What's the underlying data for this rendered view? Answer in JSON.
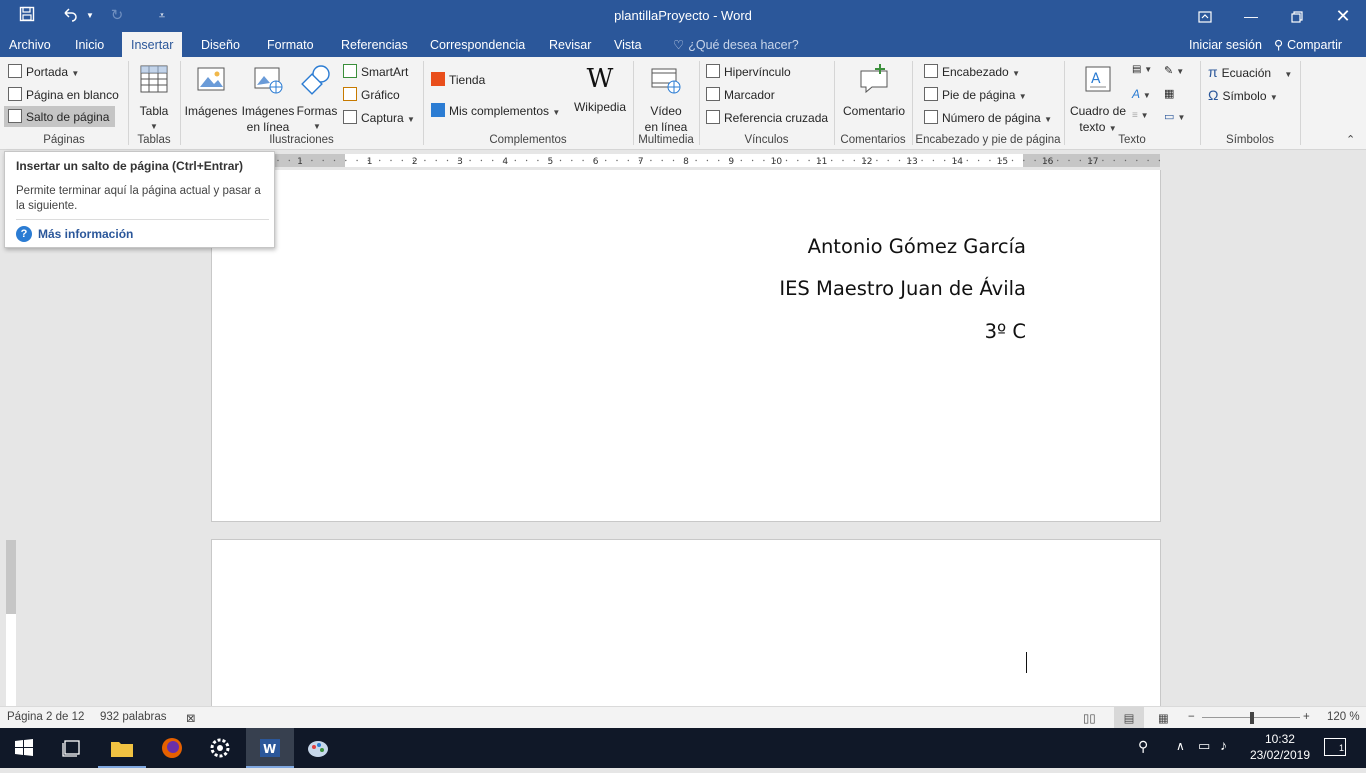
{
  "window": {
    "title": "plantillaProyecto - Word"
  },
  "tabs": {
    "archivo": "Archivo",
    "inicio": "Inicio",
    "insertar": "Insertar",
    "diseno": "Diseño",
    "formato": "Formato",
    "referencias": "Referencias",
    "correspondencia": "Correspondencia",
    "revisar": "Revisar",
    "vista": "Vista",
    "ask": "¿Qué desea hacer?",
    "signin": "Iniciar sesión",
    "share": "Compartir"
  },
  "ribbon": {
    "paginas": {
      "portada": "Portada",
      "pagina_blanco": "Página en blanco",
      "salto": "Salto de página",
      "label": "Páginas"
    },
    "tablas": {
      "tabla": "Tabla",
      "label": "Tablas"
    },
    "ilustraciones": {
      "imagenes": "Imágenes",
      "imagenes_linea_1": "Imágenes",
      "imagenes_linea_2": "en línea",
      "formas": "Formas",
      "smartart": "SmartArt",
      "grafico": "Gráfico",
      "captura": "Captura",
      "label": "Ilustraciones"
    },
    "complementos": {
      "tienda": "Tienda",
      "mis": "Mis complementos",
      "wikipedia": "Wikipedia",
      "label": "Complementos"
    },
    "multimedia": {
      "video_1": "Vídeo",
      "video_2": "en línea",
      "label": "Multimedia"
    },
    "vinculos": {
      "hipervinculo": "Hipervínculo",
      "marcador": "Marcador",
      "referencia": "Referencia cruzada",
      "label": "Vínculos"
    },
    "comentarios": {
      "comentario": "Comentario",
      "label": "Comentarios"
    },
    "encabezado": {
      "encabezado": "Encabezado",
      "pie": "Pie de página",
      "numero": "Número de página",
      "label": "Encabezado y pie de página"
    },
    "texto": {
      "cuadro_1": "Cuadro de",
      "cuadro_2": "texto",
      "label": "Texto"
    },
    "simbolos": {
      "ecuacion": "Ecuación",
      "simbolo": "Símbolo",
      "label": "Símbolos"
    }
  },
  "tooltip": {
    "title": "Insertar un salto de página (Ctrl+Entrar)",
    "body": "Permite terminar aquí la página actual y pasar a la siguiente.",
    "link": "Más información"
  },
  "document": {
    "line1": "Antonio Gómez García",
    "line2": "IES Maestro Juan de Ávila",
    "line3": "3º C"
  },
  "ruler": {
    "ticks": [
      "1",
      "1",
      "2",
      "3",
      "4",
      "5",
      "6",
      "7",
      "8",
      "9",
      "10",
      "11",
      "12",
      "13",
      "14",
      "15",
      "16",
      "17"
    ]
  },
  "status": {
    "page": "Página 2 de 12",
    "words": "932 palabras",
    "zoom": "120 %"
  },
  "taskbar": {
    "time": "10:32",
    "date": "23/02/2019",
    "notifications": "1"
  }
}
